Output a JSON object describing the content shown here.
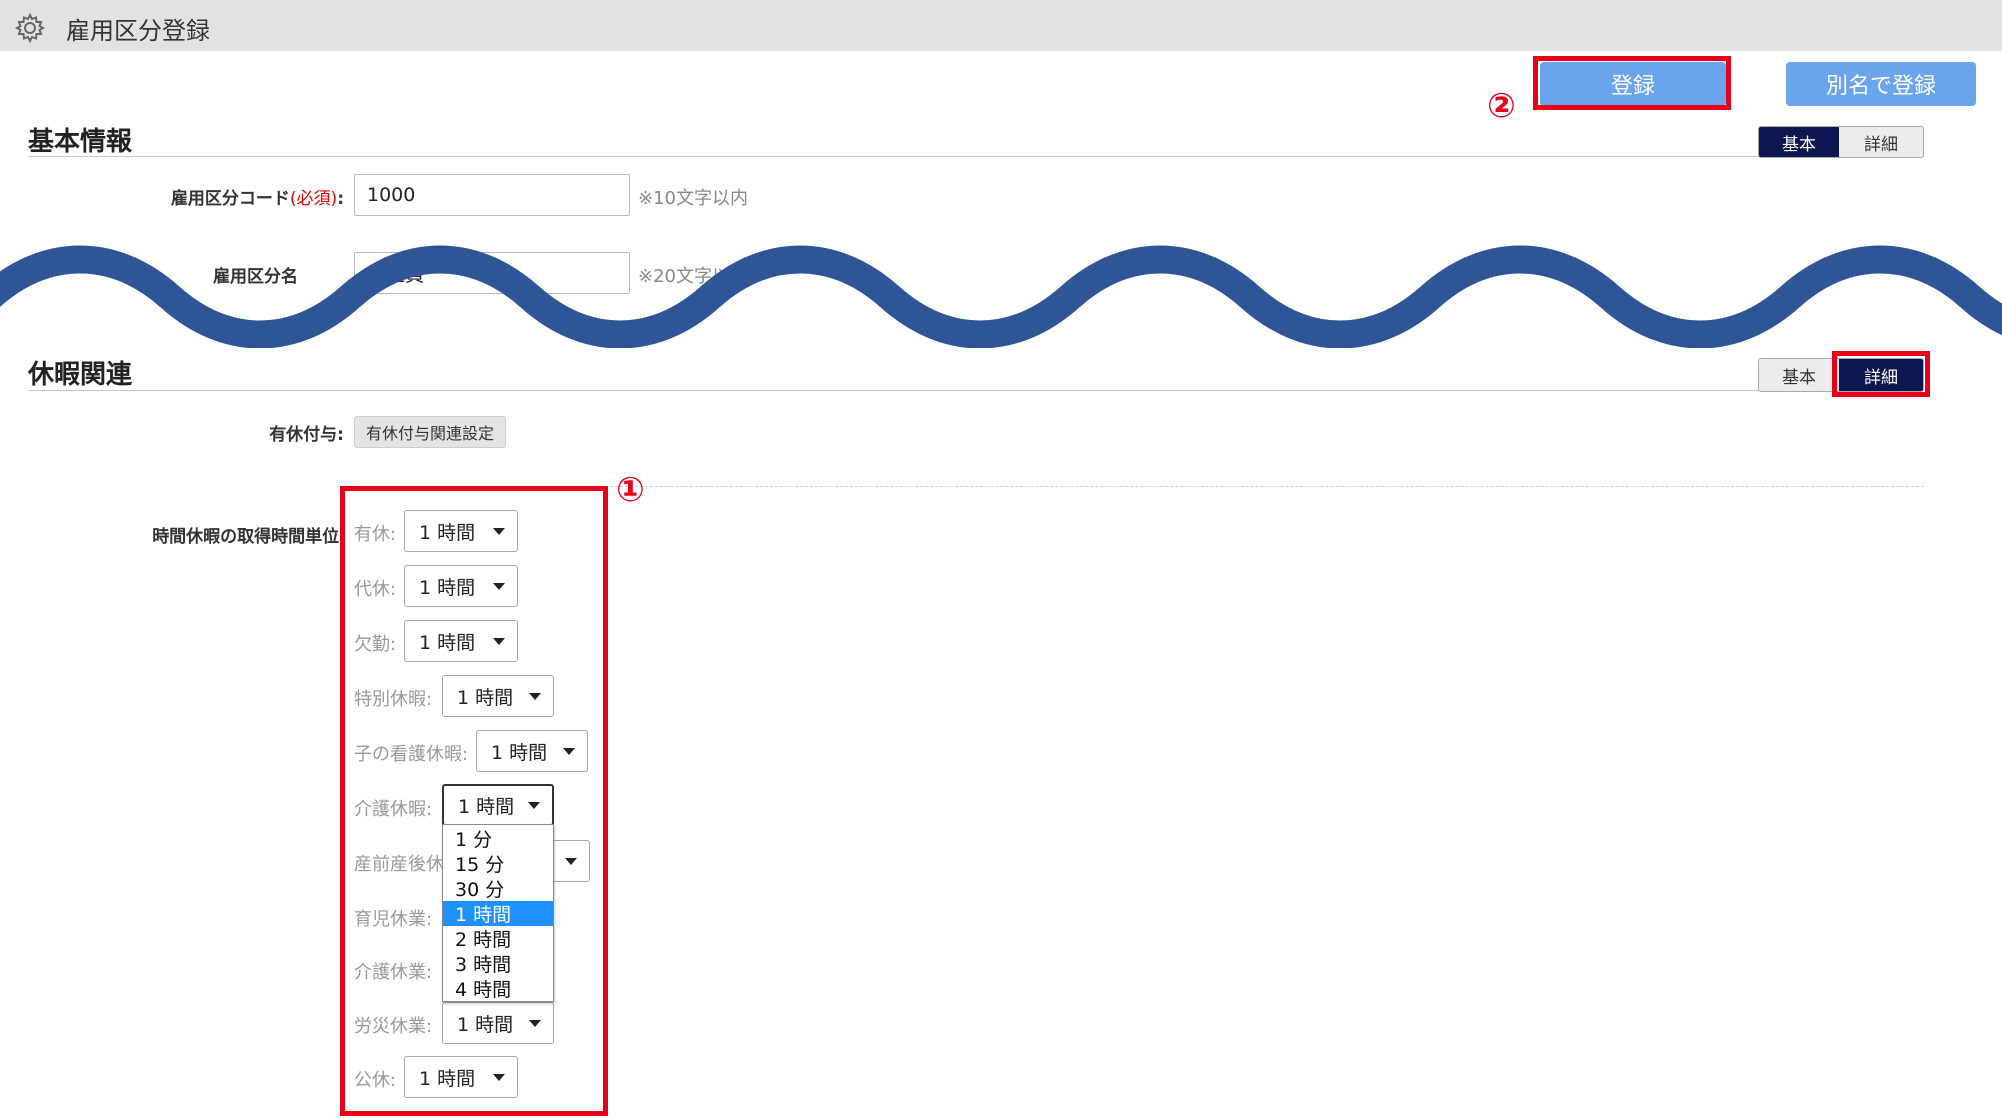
{
  "window": {
    "title": "雇用区分登録",
    "icon": "gear-icon"
  },
  "toolbar": {
    "register_label": "登録",
    "register_alias_label": "別名で登録"
  },
  "annotations": {
    "one": "①",
    "two": "②"
  },
  "basic_info": {
    "title": "基本情報",
    "toggle": {
      "basic": "基本",
      "detail": "詳細",
      "active": "basic"
    },
    "code": {
      "label": "雇用区分コード",
      "required": "(必須)",
      "colon": ":",
      "value": "1000",
      "hint": "※10文字以内"
    },
    "name": {
      "label": "雇用区分名",
      "value": "正社員",
      "hint": "※20文字以内"
    }
  },
  "leave": {
    "title": "休暇関連",
    "toggle": {
      "basic": "基本",
      "detail": "詳細",
      "active": "detail"
    },
    "paid_grant": {
      "label": "有休付与:",
      "button": "有休付与関連設定"
    },
    "unit_label": "時間休暇の取得時間単位:",
    "rows": [
      {
        "label": "有休:",
        "value": "1 時間"
      },
      {
        "label": "代休:",
        "value": "1 時間"
      },
      {
        "label": "欠勤:",
        "value": "1 時間"
      },
      {
        "label": "特別休暇:",
        "value": "1 時間"
      },
      {
        "label": "子の看護休暇:",
        "value": "1 時間"
      },
      {
        "label": "介護休暇:",
        "value": "1 時間"
      },
      {
        "label": "産前産後休",
        "value": ""
      },
      {
        "label": "育児休業:",
        "value": ""
      },
      {
        "label": "介護休業:",
        "value": ""
      },
      {
        "label": "労災休業:",
        "value": "1 時間"
      },
      {
        "label": "公休:",
        "value": "1 時間"
      }
    ],
    "dropdown_options": [
      "1 分",
      "15 分",
      "30 分",
      "1 時間",
      "2 時間",
      "3 時間",
      "4 時間"
    ],
    "dropdown_selected": "1 時間"
  },
  "colors": {
    "accent_button": "#6aa4ec",
    "highlight_red": "#e6001a",
    "wave": "#2e5597",
    "toggle_active": "#0d1650",
    "option_selected": "#1e90ff"
  }
}
